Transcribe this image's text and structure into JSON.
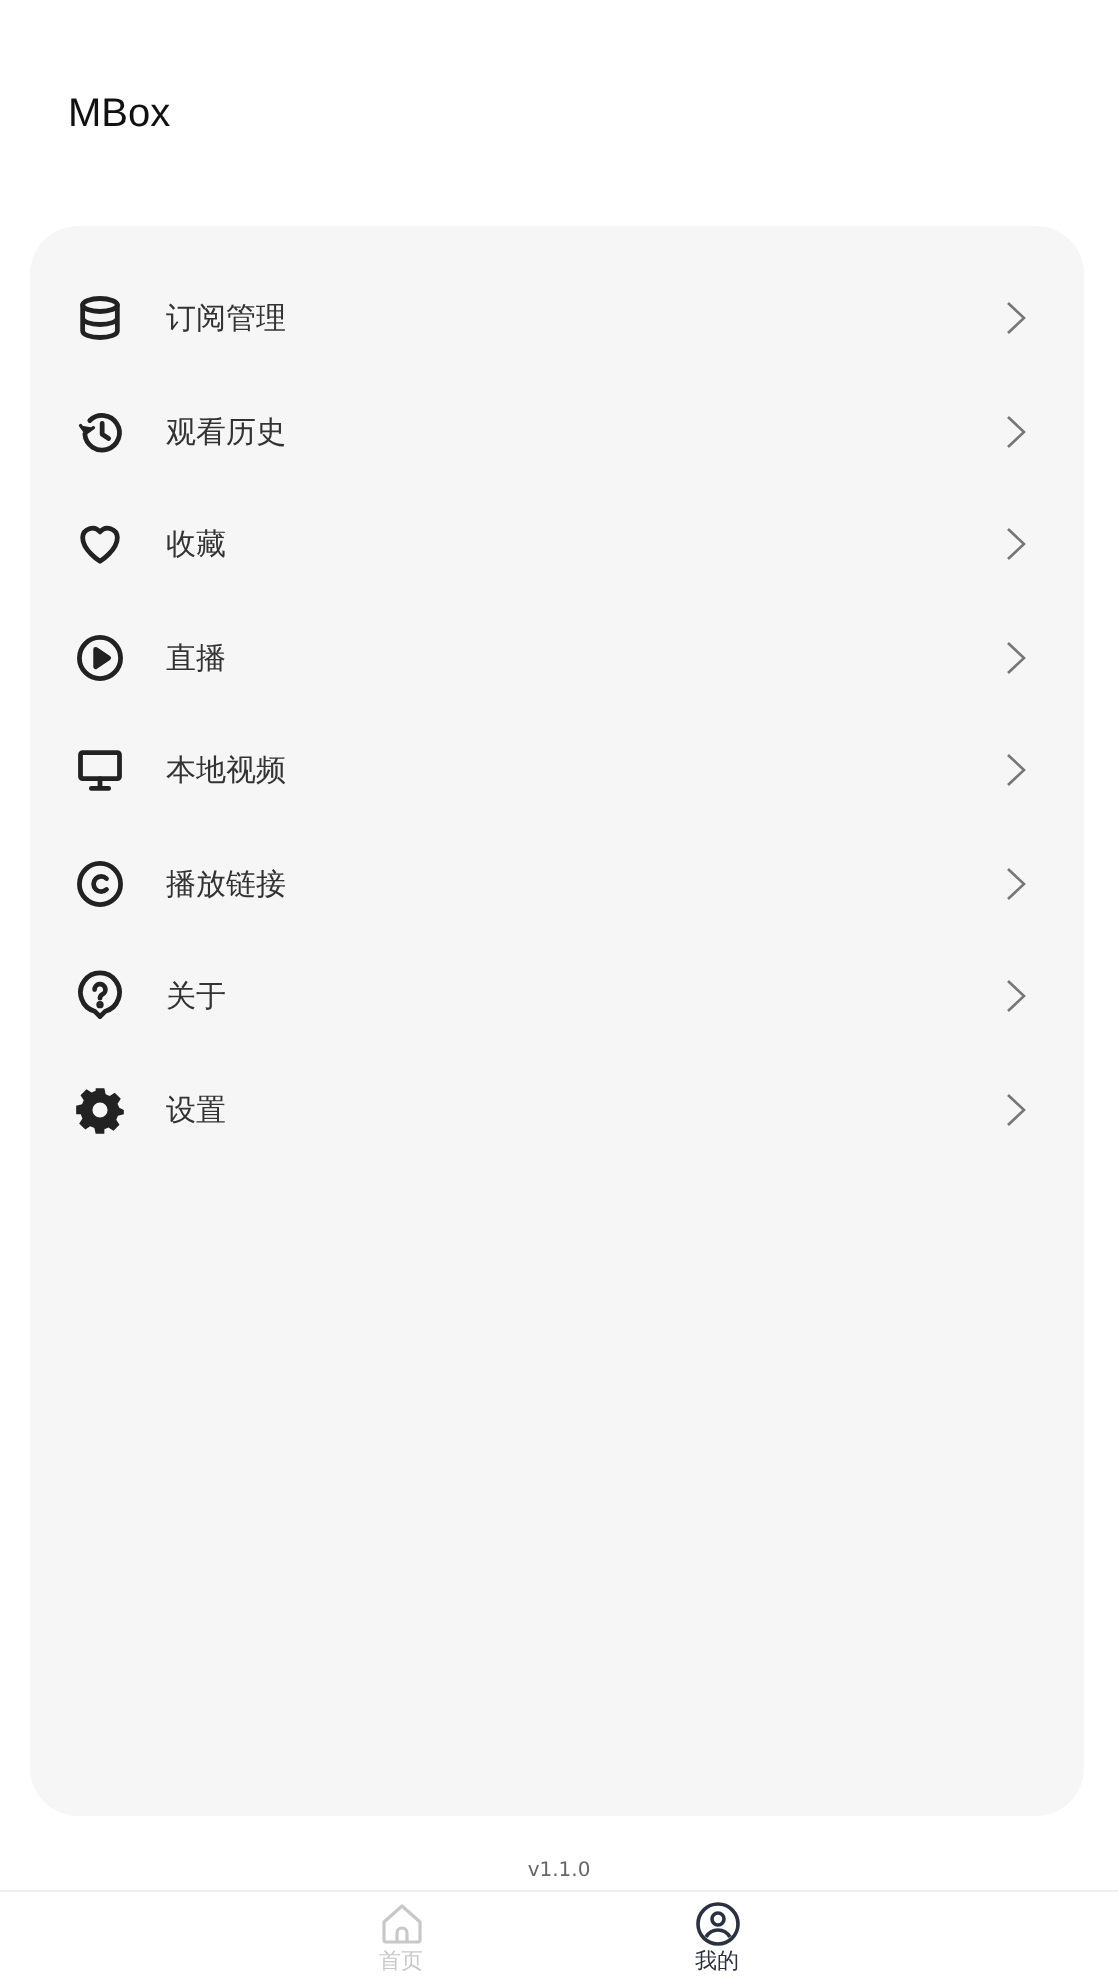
{
  "app_title": "MBox",
  "menu": [
    {
      "label": "订阅管理"
    },
    {
      "label": "观看历史"
    },
    {
      "label": "收藏"
    },
    {
      "label": "直播"
    },
    {
      "label": "本地视频"
    },
    {
      "label": "播放链接"
    },
    {
      "label": "关于"
    },
    {
      "label": "设置"
    }
  ],
  "version": "v1.1.0",
  "tabs": [
    {
      "label": "首页",
      "selected": false
    },
    {
      "label": "我的",
      "selected": true
    }
  ]
}
